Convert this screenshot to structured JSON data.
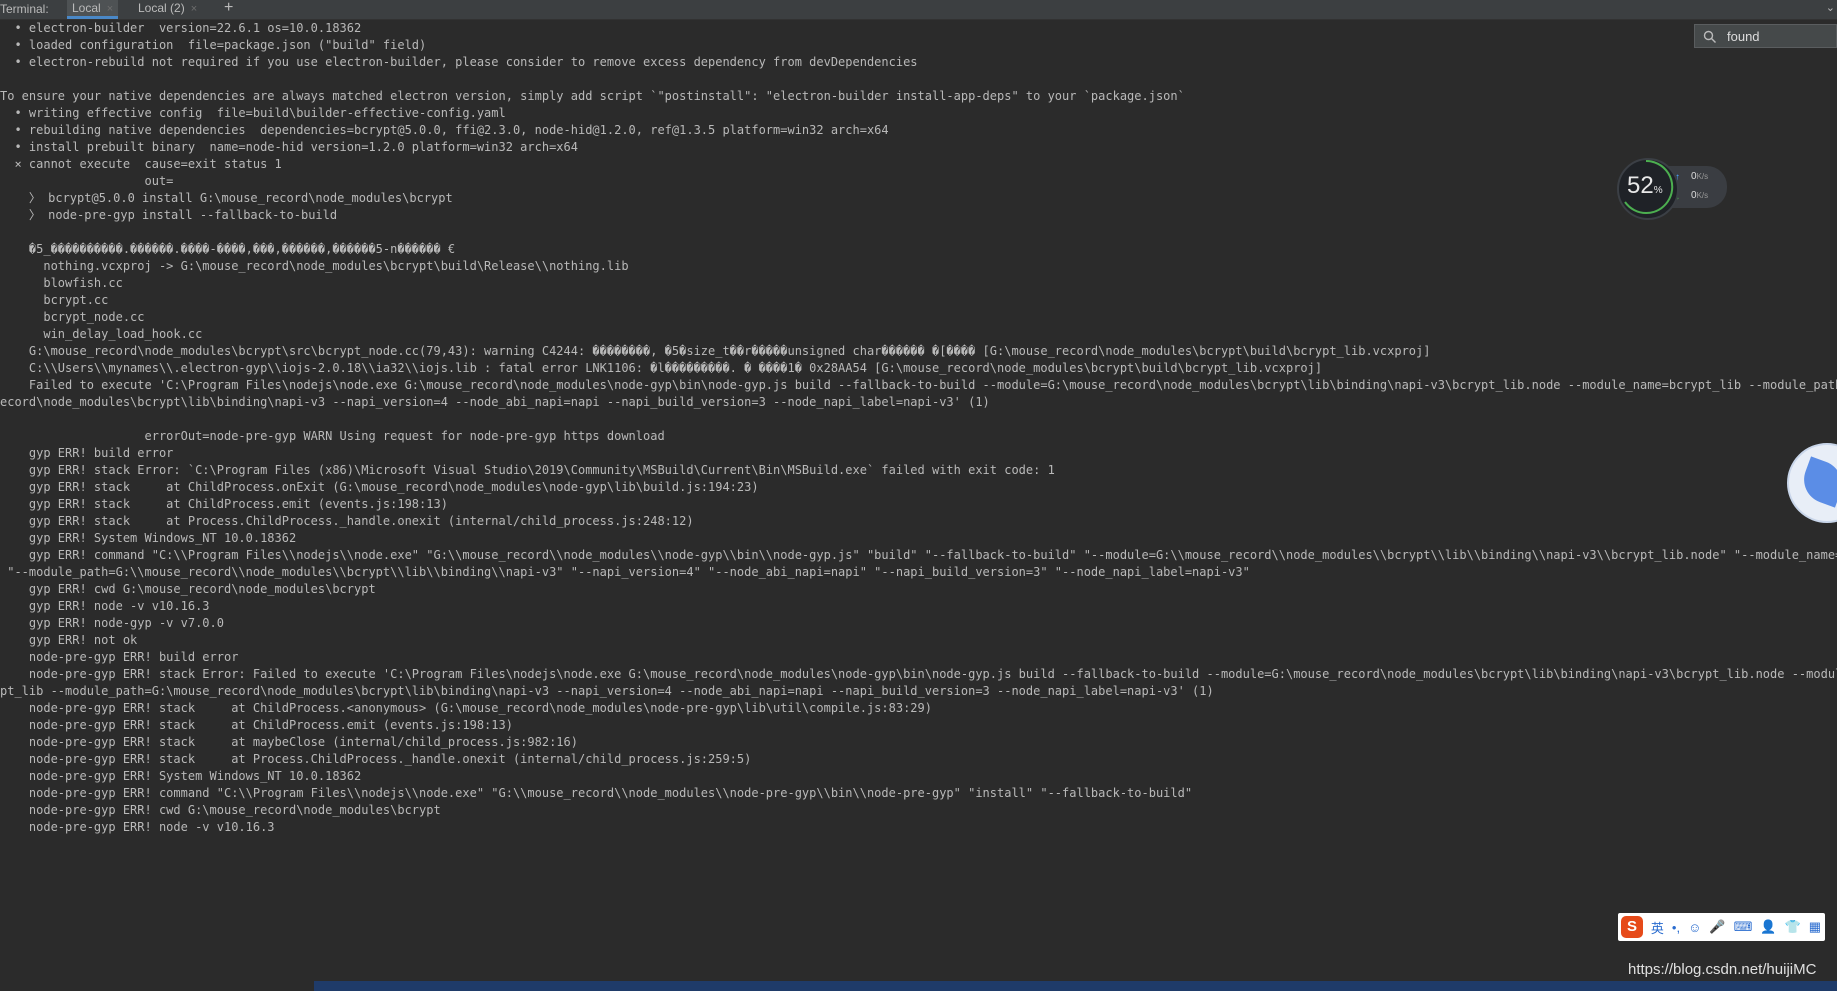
{
  "tabbar": {
    "prefix": "Terminal:",
    "tabs": [
      {
        "label": "Local",
        "active": true
      },
      {
        "label": "Local (2)",
        "active": false
      }
    ],
    "add_label": "+",
    "close_glyph": "×"
  },
  "search": {
    "value": "found",
    "icon": "search-icon"
  },
  "net_widget": {
    "percent": "52",
    "percent_unit": "%",
    "up": "0",
    "down": "0",
    "rate_unit": "K/s"
  },
  "ime": {
    "logo": "S",
    "mode": "英"
  },
  "watermark": "https://blog.csdn.net/huijiMC",
  "terminal": {
    "lines": [
      "  • electron-builder  version=22.6.1 os=10.0.18362",
      "  • loaded configuration  file=package.json (\"build\" field)",
      "  • electron-rebuild not required if you use electron-builder, please consider to remove excess dependency from devDependencies",
      "",
      "To ensure your native dependencies are always matched electron version, simply add script `\"postinstall\": \"electron-builder install-app-deps\" to your `package.json`",
      "  • writing effective config  file=build\\builder-effective-config.yaml",
      "  • rebuilding native dependencies  dependencies=bcrypt@5.0.0, ffi@2.3.0, node-hid@1.2.0, ref@1.3.5 platform=win32 arch=x64",
      "  • install prebuilt binary  name=node-hid version=1.2.0 platform=win32 arch=x64",
      "  ⨯ cannot execute  cause=exit status 1",
      "                    out=",
      "    〉 bcrypt@5.0.0 install G:\\mouse_record\\node_modules\\bcrypt",
      "    〉 node-pre-gyp install --fallback-to-build",
      "",
      "    �5_����������.������.����-����,���,������,������5-n������ €",
      "      nothing.vcxproj -> G:\\mouse_record\\node_modules\\bcrypt\\build\\Release\\\\nothing.lib",
      "      blowfish.cc",
      "      bcrypt.cc",
      "      bcrypt_node.cc",
      "      win_delay_load_hook.cc",
      "    G:\\mouse_record\\node_modules\\bcrypt\\src\\bcrypt_node.cc(79,43): warning C4244: ��������, �5�size_t��r�����unsigned char������ �[���� [G:\\mouse_record\\node_modules\\bcrypt\\build\\bcrypt_lib.vcxproj]",
      "    C:\\\\Users\\\\mynames\\\\.electron-gyp\\\\iojs-2.0.18\\\\ia32\\\\iojs.lib : fatal error LNK1106: �l���������. � ����1� 0x28AA54 [G:\\mouse_record\\node_modules\\bcrypt\\build\\bcrypt_lib.vcxproj]",
      "    Failed to execute 'C:\\Program Files\\nodejs\\node.exe G:\\mouse_record\\node_modules\\node-gyp\\bin\\node-gyp.js build --fallback-to-build --module=G:\\mouse_record\\node_modules\\bcrypt\\lib\\binding\\napi-v3\\bcrypt_lib.node --module_name=bcrypt_lib --module_path=G:\\mouse_r",
      "ecord\\node_modules\\bcrypt\\lib\\binding\\napi-v3 --napi_version=4 --node_abi_napi=napi --napi_build_version=3 --node_napi_label=napi-v3' (1)",
      "",
      "                    errorOut=node-pre-gyp WARN Using request for node-pre-gyp https download",
      "    gyp ERR! build error",
      "    gyp ERR! stack Error: `C:\\Program Files (x86)\\Microsoft Visual Studio\\2019\\Community\\MSBuild\\Current\\Bin\\MSBuild.exe` failed with exit code: 1",
      "    gyp ERR! stack     at ChildProcess.onExit (G:\\mouse_record\\node_modules\\node-gyp\\lib\\build.js:194:23)",
      "    gyp ERR! stack     at ChildProcess.emit (events.js:198:13)",
      "    gyp ERR! stack     at Process.ChildProcess._handle.onexit (internal/child_process.js:248:12)",
      "    gyp ERR! System Windows_NT 10.0.18362",
      "    gyp ERR! command \"C:\\\\Program Files\\\\nodejs\\\\node.exe\" \"G:\\\\mouse_record\\\\node_modules\\\\node-gyp\\\\bin\\\\node-gyp.js\" \"build\" \"--fallback-to-build\" \"--module=G:\\\\mouse_record\\\\node_modules\\\\bcrypt\\\\lib\\\\binding\\\\napi-v3\\\\bcrypt_lib.node\" \"--module_name=bcrypt_lib\"",
      " \"--module_path=G:\\\\mouse_record\\\\node_modules\\\\bcrypt\\\\lib\\\\binding\\\\napi-v3\" \"--napi_version=4\" \"--node_abi_napi=napi\" \"--napi_build_version=3\" \"--node_napi_label=napi-v3\"",
      "    gyp ERR! cwd G:\\mouse_record\\node_modules\\bcrypt",
      "    gyp ERR! node -v v10.16.3",
      "    gyp ERR! node-gyp -v v7.0.0",
      "    gyp ERR! not ok",
      "    node-pre-gyp ERR! build error",
      "    node-pre-gyp ERR! stack Error: Failed to execute 'C:\\Program Files\\nodejs\\node.exe G:\\mouse_record\\node_modules\\node-gyp\\bin\\node-gyp.js build --fallback-to-build --module=G:\\mouse_record\\node_modules\\bcrypt\\lib\\binding\\napi-v3\\bcrypt_lib.node --module_name=bcry",
      "pt_lib --module_path=G:\\mouse_record\\node_modules\\bcrypt\\lib\\binding\\napi-v3 --napi_version=4 --node_abi_napi=napi --napi_build_version=3 --node_napi_label=napi-v3' (1)",
      "    node-pre-gyp ERR! stack     at ChildProcess.<anonymous> (G:\\mouse_record\\node_modules\\node-pre-gyp\\lib\\util\\compile.js:83:29)",
      "    node-pre-gyp ERR! stack     at ChildProcess.emit (events.js:198:13)",
      "    node-pre-gyp ERR! stack     at maybeClose (internal/child_process.js:982:16)",
      "    node-pre-gyp ERR! stack     at Process.ChildProcess._handle.onexit (internal/child_process.js:259:5)",
      "    node-pre-gyp ERR! System Windows_NT 10.0.18362",
      "    node-pre-gyp ERR! command \"C:\\\\Program Files\\\\nodejs\\\\node.exe\" \"G:\\\\mouse_record\\\\node_modules\\\\node-pre-gyp\\\\bin\\\\node-pre-gyp\" \"install\" \"--fallback-to-build\"",
      "    node-pre-gyp ERR! cwd G:\\mouse_record\\node_modules\\bcrypt",
      "    node-pre-gyp ERR! node -v v10.16.3"
    ]
  }
}
